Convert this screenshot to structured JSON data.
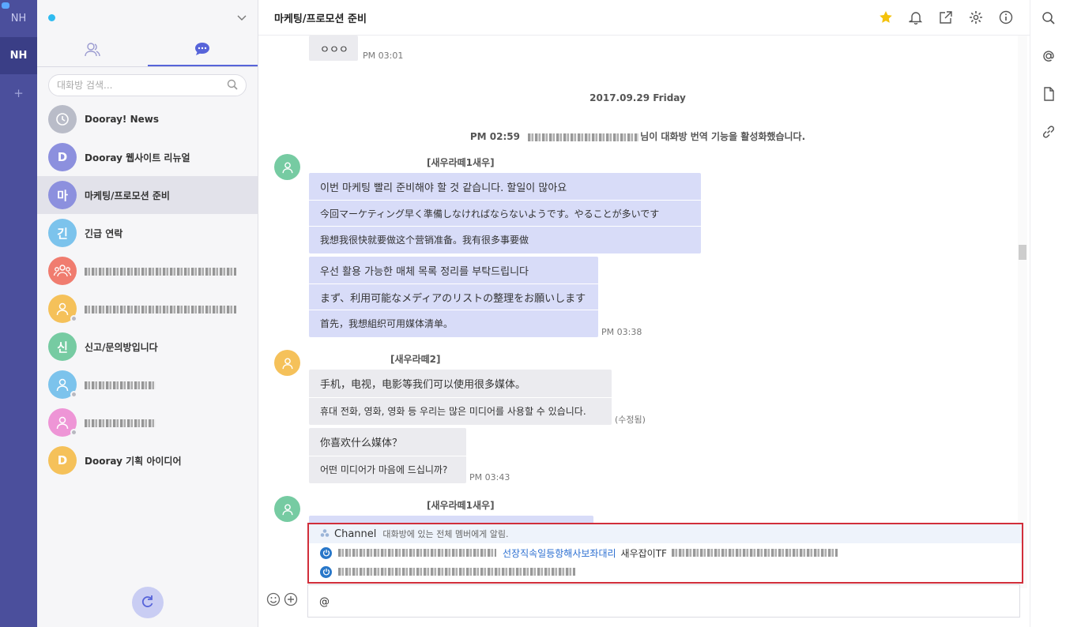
{
  "rail": {
    "org_top": "NH",
    "org_active": "NH",
    "add": "+"
  },
  "sidebar": {
    "search_placeholder": "대화방 검색...",
    "rooms": [
      {
        "name": "Dooray! News",
        "avatar": "",
        "color": "#b9bcc8"
      },
      {
        "name": "Dooray 웹사이트 리뉴얼",
        "avatar": "D",
        "color": "#8c90de"
      },
      {
        "name": "마케팅/프로모션 준비",
        "avatar": "마",
        "color": "#8c90de"
      },
      {
        "name": "긴급 연락",
        "avatar": "긴",
        "color": "#7cc3ec"
      },
      {
        "name": "",
        "avatar": "",
        "color": "#f07c6f"
      },
      {
        "name": "",
        "avatar": "",
        "color": "#f5c15a"
      },
      {
        "name": "신고/문의방입니다",
        "avatar": "신",
        "color": "#76cba2"
      },
      {
        "name": "",
        "avatar": "",
        "color": "#7cc3ec"
      },
      {
        "name": "",
        "avatar": "",
        "color": "#ee95d6"
      },
      {
        "name": "Dooray 기획 아이디어",
        "avatar": "D",
        "color": "#f5c15a"
      }
    ]
  },
  "header": {
    "title": "마케팅/프로모션 준비"
  },
  "messages": {
    "top_bubble": "ㅇㅇㅇ",
    "top_time": "PM 03:01",
    "date": "2017.09.29 Friday",
    "system_prefix": "PM 02:59",
    "system_suffix": "님이 대화방 번역 기능을 활성화했습니다.",
    "sender1": "[새우라떼1새우]",
    "b1_l1": "이번 마케팅 빨리 준비해야 할 것 같습니다. 할일이 많아요",
    "b1_l2": "今回マーケティング早く準備しなければならないようです。やることが多いです",
    "b1_l3": "我想我很快就要做这个营销准备。我有很多事要做",
    "b2_l1": "우선 활용 가능한 매체 목록 정리를 부탁드립니다",
    "b2_l2": "まず、利用可能なメディアのリストの整理をお願いします",
    "b2_l3": "首先，我想組织可用媒体清单。",
    "time2": "PM 03:38",
    "sender2": "[새우라떼2]",
    "b3_l1": "手机，电视，电影等我们可以使用很多媒体。",
    "b3_l2": "휴대 전화, 영화, 영화 등 우리는 많은 미디어를 사용할 수 있습니다.",
    "edited": "(수정됨)",
    "b4_l1": "你喜欢什么媒体？",
    "b4_l2": "어떤 미디어가 마음에 드십니까?",
    "time4": "PM 03:43",
    "sender3": "[새우라떼1새우]"
  },
  "mention": {
    "channel_label": "Channel",
    "channel_desc": "대화방에 있는 전체 멤버에게 알림.",
    "user1_dept": "선장직속일등항해사보좌대리",
    "user1_pos": "새우잡이TF"
  },
  "composer": {
    "value": "@"
  }
}
